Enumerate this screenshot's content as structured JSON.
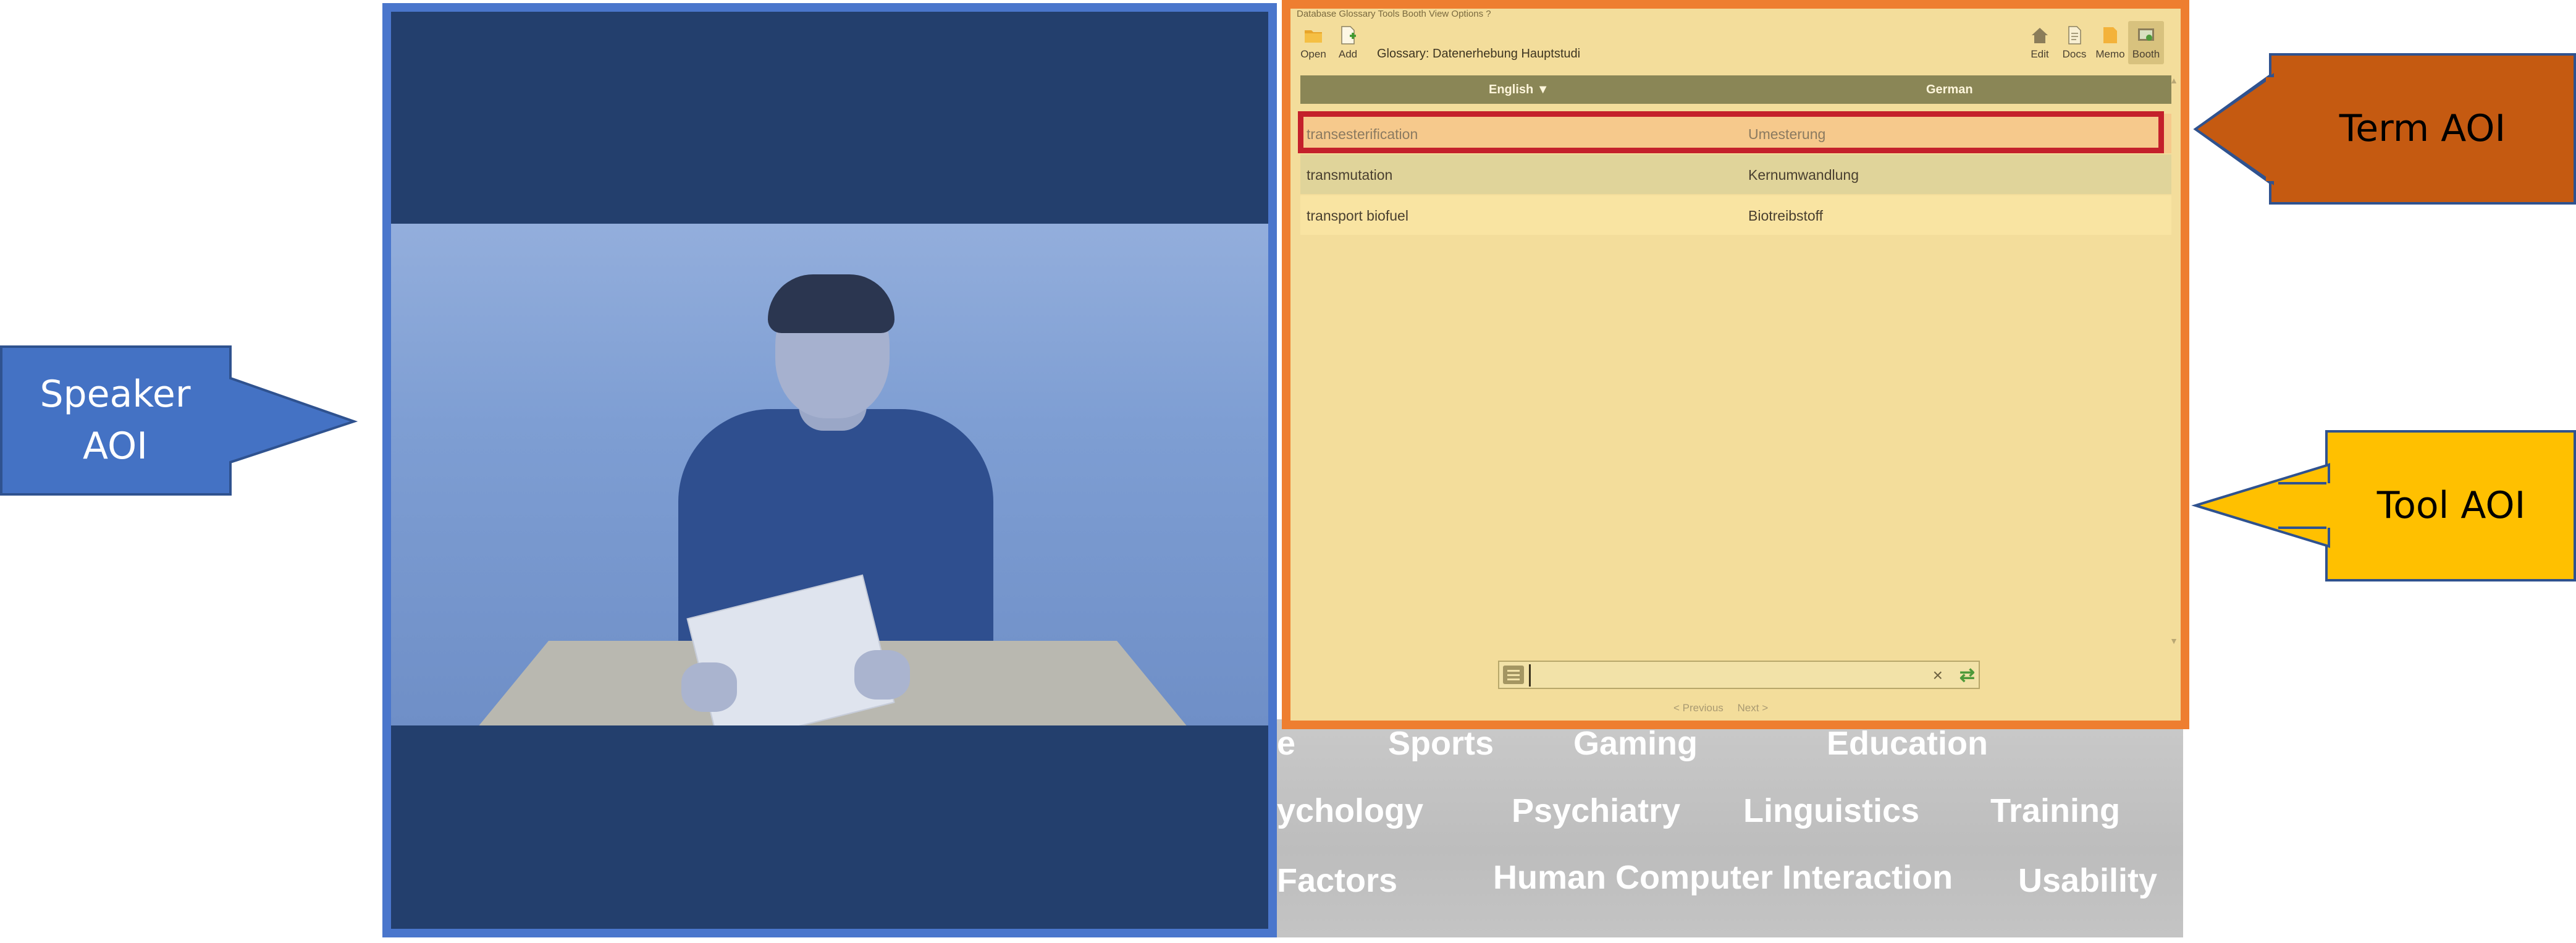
{
  "callouts": {
    "speaker": {
      "line1": "Speaker",
      "line2": "AOI",
      "color": "#4472c4"
    },
    "term": {
      "label": "Term AOI",
      "color": "#c55a11"
    },
    "tool": {
      "label": "Tool AOI",
      "color": "#ffc000"
    }
  },
  "aoi_colors": {
    "speaker_frame": "#4a76cc",
    "tool_frame": "#ee7e30",
    "term_box": "#c4202b"
  },
  "app": {
    "menu": "Database  Glossary  Tools  Booth  View  Options  ?",
    "toolbar": {
      "open": "Open",
      "add": "Add",
      "edit": "Edit",
      "docs": "Docs",
      "memo": "Memo",
      "booth": "Booth"
    },
    "glossary_title": "Glossary: Datenerhebung Hauptstudi",
    "columns": {
      "source": "English ▼",
      "target": "German"
    },
    "rows": [
      {
        "source": "transesterification",
        "target": "Umesterung"
      },
      {
        "source": "transmutation",
        "target": "Kernumwandlung"
      },
      {
        "source": "transport biofuel",
        "target": "Biotreibstoff"
      }
    ],
    "search": {
      "value": "",
      "placeholder": ""
    },
    "pager": {
      "previous": "< Previous",
      "next": "Next >"
    }
  },
  "background_keywords": {
    "row1": [
      "e",
      "Sports",
      "Gaming",
      "Education"
    ],
    "row2": [
      "ychology",
      "Psychiatry",
      "Linguistics",
      "Training"
    ],
    "row3": [
      "Factors",
      "Human Computer Interaction",
      "Usability"
    ]
  }
}
